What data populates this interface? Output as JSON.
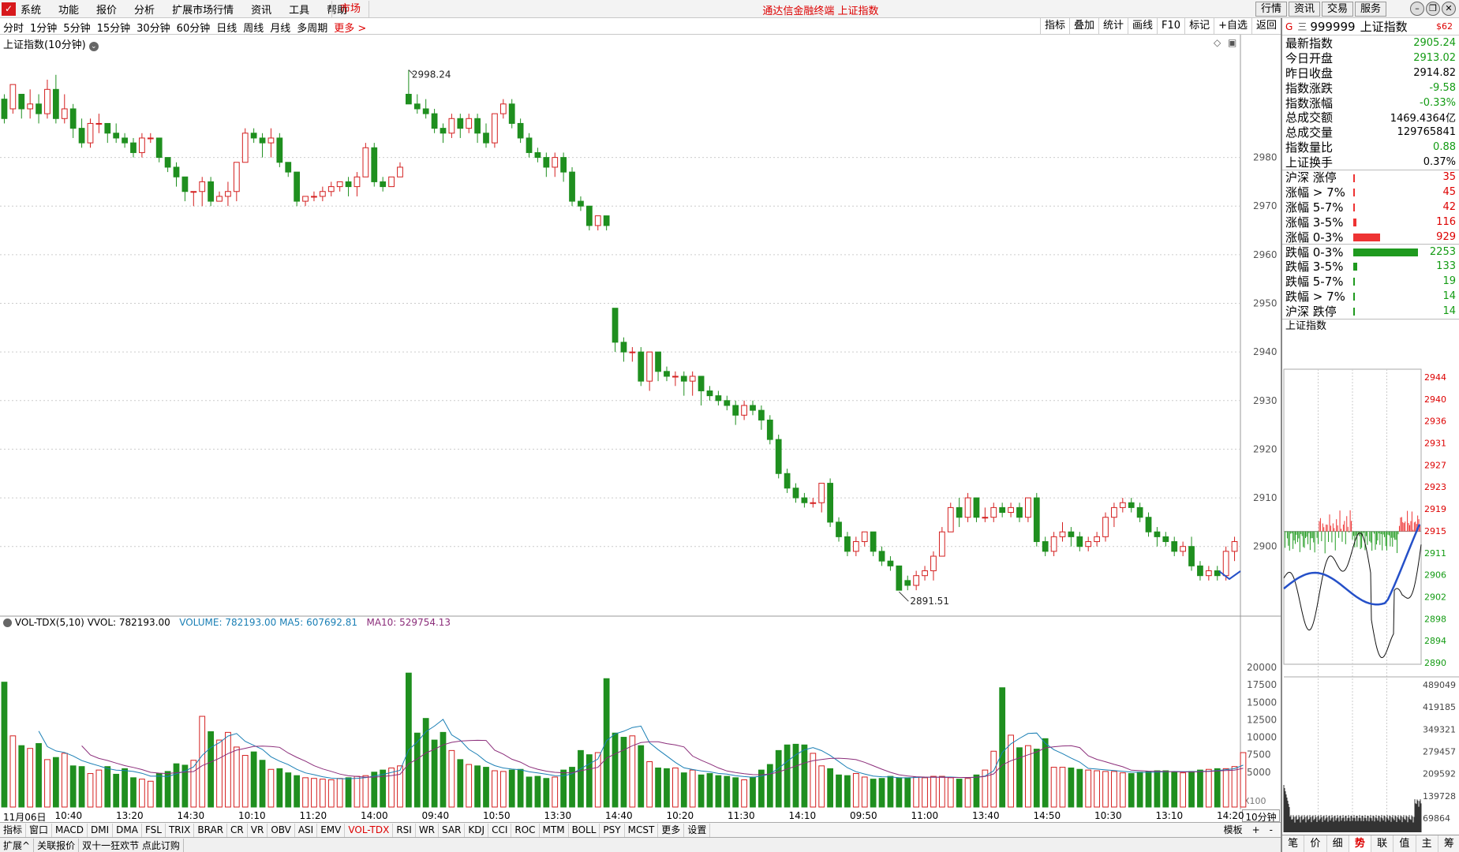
{
  "app": {
    "menu": [
      "系统",
      "功能",
      "报价",
      "分析",
      "扩展市场行情",
      "资讯",
      "工具",
      "帮助"
    ],
    "market_tab": "市场",
    "title": "通达信金融终端  上证指数",
    "right_buttons": [
      "行情",
      "资讯",
      "交易",
      "服务"
    ],
    "window_controls": [
      "minimize-icon",
      "restore-icon",
      "close-icon"
    ]
  },
  "toolbar": {
    "periods": [
      "分时",
      "1分钟",
      "5分钟",
      "15分钟",
      "30分钟",
      "60分钟",
      "日线",
      "周线",
      "月线",
      "多周期"
    ],
    "more": "更多 >",
    "tools": [
      "指标",
      "叠加",
      "统计",
      "画线",
      "F10",
      "标记",
      "+自选",
      "返回"
    ]
  },
  "main_chart": {
    "label": "上证指数(10分钟)",
    "price_axis": [
      "2980",
      "2970",
      "2960",
      "2950",
      "2940",
      "2930",
      "2920",
      "2910",
      "2900"
    ],
    "high_label": "2998.24",
    "low_label": "2891.51",
    "up_color": "#d42020",
    "down_color": "#1f8f1f"
  },
  "chart_data": {
    "type": "candlestick",
    "title": "上证指数(10分钟)",
    "ylim": [
      2886,
      3002
    ],
    "candles": [
      [
        2992,
        2993,
        2988,
        2987
      ],
      [
        2990,
        2995,
        2995,
        2989
      ],
      [
        2993,
        2993,
        2990,
        2988
      ],
      [
        2990,
        2994,
        2991,
        2988
      ],
      [
        2991,
        2993,
        2989,
        2987
      ],
      [
        2989,
        2996,
        2994,
        2988
      ],
      [
        2994,
        2997,
        2988,
        2987
      ],
      [
        2988,
        2993,
        2990,
        2987
      ],
      [
        2990,
        2991,
        2986,
        2984
      ],
      [
        2986,
        2988,
        2983,
        2982
      ],
      [
        2983,
        2988,
        2987,
        2982
      ],
      [
        2987,
        2989,
        2987,
        2985
      ],
      [
        2987,
        2987,
        2985,
        2983
      ],
      [
        2985,
        2987,
        2984,
        2983
      ],
      [
        2984,
        2985,
        2983,
        2982
      ],
      [
        2983,
        2984,
        2981,
        2980
      ],
      [
        2981,
        2985,
        2984,
        2980
      ],
      [
        2984,
        2985,
        2984,
        2983
      ],
      [
        2984,
        2984,
        2980,
        2979
      ],
      [
        2980,
        2980,
        2978,
        2977
      ],
      [
        2978,
        2979,
        2976,
        2974
      ],
      [
        2976,
        2976,
        2973,
        2971
      ],
      [
        2973,
        2973,
        2973,
        2970
      ],
      [
        2973,
        2976,
        2975,
        2970
      ],
      [
        2975,
        2976,
        2971,
        2970
      ],
      [
        2971,
        2973,
        2972,
        2971
      ],
      [
        2972,
        2975,
        2973,
        2970
      ],
      [
        2973,
        2979,
        2979,
        2971
      ],
      [
        2979,
        2986,
        2985,
        2979
      ],
      [
        2985,
        2986,
        2984,
        2983
      ],
      [
        2984,
        2985,
        2983,
        2980
      ],
      [
        2983,
        2986,
        2984,
        2980
      ],
      [
        2984,
        2985,
        2979,
        2978
      ],
      [
        2979,
        2979,
        2977,
        2976
      ],
      [
        2977,
        2977,
        2971,
        2970
      ],
      [
        2971,
        2972,
        2972,
        2970
      ],
      [
        2972,
        2973,
        2972,
        2971
      ],
      [
        2972,
        2974,
        2973,
        2971
      ],
      [
        2973,
        2975,
        2974,
        2972
      ],
      [
        2974,
        2975,
        2975,
        2973
      ],
      [
        2975,
        2976,
        2974,
        2972
      ],
      [
        2974,
        2977,
        2976,
        2972
      ],
      [
        2976,
        2983,
        2982,
        2976
      ],
      [
        2982,
        2983,
        2975,
        2974
      ],
      [
        2975,
        2976,
        2974,
        2973
      ],
      [
        2974,
        2976,
        2976,
        2974
      ],
      [
        2976,
        2979,
        2978,
        2976
      ],
      [
        2993,
        2998,
        2991,
        2991
      ],
      [
        2991,
        2993,
        2990,
        2989
      ],
      [
        2990,
        2992,
        2989,
        2988
      ],
      [
        2989,
        2990,
        2986,
        2985
      ],
      [
        2986,
        2987,
        2985,
        2983
      ],
      [
        2985,
        2989,
        2988,
        2984
      ],
      [
        2988,
        2989,
        2986,
        2984
      ],
      [
        2986,
        2989,
        2988,
        2985
      ],
      [
        2988,
        2989,
        2985,
        2983
      ],
      [
        2985,
        2987,
        2983,
        2982
      ],
      [
        2983,
        2989,
        2989,
        2982
      ],
      [
        2989,
        2992,
        2991,
        2988
      ],
      [
        2991,
        2992,
        2987,
        2986
      ],
      [
        2987,
        2988,
        2984,
        2983
      ],
      [
        2984,
        2985,
        2981,
        2980
      ],
      [
        2981,
        2982,
        2980,
        2979
      ],
      [
        2980,
        2981,
        2978,
        2976
      ],
      [
        2978,
        2981,
        2980,
        2976
      ],
      [
        2980,
        2981,
        2977,
        2975
      ],
      [
        2977,
        2978,
        2971,
        2970
      ],
      [
        2971,
        2972,
        2970,
        2969
      ],
      [
        2970,
        2970,
        2966,
        2965
      ],
      [
        2966,
        2968,
        2968,
        2965
      ],
      [
        2968,
        2968,
        2966,
        2965
      ],
      [
        2949,
        2949,
        2942,
        2940
      ],
      [
        2942,
        2943,
        2940,
        2938
      ],
      [
        2940,
        2941,
        2940,
        2938
      ],
      [
        2940,
        2941,
        2934,
        2933
      ],
      [
        2934,
        2940,
        2940,
        2932
      ],
      [
        2940,
        2940,
        2936,
        2934
      ],
      [
        2936,
        2937,
        2935,
        2934
      ],
      [
        2935,
        2936,
        2935,
        2933
      ],
      [
        2935,
        2936,
        2934,
        2931
      ],
      [
        2934,
        2936,
        2935,
        2931
      ],
      [
        2935,
        2935,
        2932,
        2929
      ],
      [
        2932,
        2933,
        2931,
        2930
      ],
      [
        2931,
        2932,
        2930,
        2929
      ],
      [
        2930,
        2931,
        2929,
        2928
      ],
      [
        2929,
        2930,
        2927,
        2925
      ],
      [
        2927,
        2930,
        2929,
        2926
      ],
      [
        2929,
        2930,
        2928,
        2927
      ],
      [
        2928,
        2929,
        2926,
        2924
      ],
      [
        2926,
        2927,
        2922,
        2921
      ],
      [
        2922,
        2923,
        2915,
        2914
      ],
      [
        2915,
        2916,
        2912,
        2911
      ],
      [
        2912,
        2913,
        2910,
        2909
      ],
      [
        2910,
        2911,
        2909,
        2908
      ],
      [
        2909,
        2910,
        2909,
        2908
      ],
      [
        2909,
        2913,
        2913,
        2907
      ],
      [
        2913,
        2914,
        2905,
        2904
      ],
      [
        2905,
        2906,
        2902,
        2901
      ],
      [
        2902,
        2903,
        2899,
        2898
      ],
      [
        2899,
        2902,
        2901,
        2898
      ],
      [
        2901,
        2903,
        2903,
        2900
      ],
      [
        2903,
        2903,
        2899,
        2898
      ],
      [
        2899,
        2900,
        2897,
        2896
      ],
      [
        2897,
        2898,
        2896,
        2895
      ],
      [
        2896,
        2896,
        2891,
        2891
      ],
      [
        2893,
        2894,
        2892,
        2891
      ],
      [
        2892,
        2895,
        2894,
        2891
      ],
      [
        2894,
        2896,
        2895,
        2893
      ],
      [
        2895,
        2899,
        2898,
        2893
      ],
      [
        2898,
        2904,
        2903,
        2898
      ],
      [
        2903,
        2909,
        2908,
        2903
      ],
      [
        2908,
        2910,
        2906,
        2904
      ],
      [
        2906,
        2911,
        2910,
        2905
      ],
      [
        2910,
        2910,
        2906,
        2905
      ],
      [
        2906,
        2908,
        2906,
        2905
      ],
      [
        2906,
        2909,
        2908,
        2905
      ],
      [
        2908,
        2909,
        2907,
        2906
      ],
      [
        2907,
        2909,
        2908,
        2906
      ],
      [
        2908,
        2909,
        2906,
        2905
      ],
      [
        2906,
        2910,
        2910,
        2905
      ],
      [
        2910,
        2911,
        2901,
        2900
      ],
      [
        2901,
        2902,
        2899,
        2898
      ],
      [
        2899,
        2903,
        2902,
        2898
      ],
      [
        2902,
        2905,
        2903,
        2901
      ],
      [
        2903,
        2904,
        2902,
        2900
      ],
      [
        2902,
        2903,
        2900,
        2899
      ],
      [
        2900,
        2902,
        2901,
        2899
      ],
      [
        2901,
        2903,
        2902,
        2900
      ],
      [
        2902,
        2907,
        2906,
        2901
      ],
      [
        2906,
        2909,
        2908,
        2904
      ],
      [
        2908,
        2910,
        2909,
        2907
      ],
      [
        2909,
        2910,
        2908,
        2907
      ],
      [
        2908,
        2909,
        2906,
        2905
      ],
      [
        2906,
        2907,
        2903,
        2902
      ],
      [
        2903,
        2904,
        2902,
        2900
      ],
      [
        2902,
        2903,
        2901,
        2900
      ],
      [
        2901,
        2902,
        2899,
        2898
      ],
      [
        2899,
        2901,
        2900,
        2898
      ],
      [
        2900,
        2902,
        2896,
        2895
      ],
      [
        2896,
        2897,
        2894,
        2893
      ],
      [
        2894,
        2896,
        2895,
        2893
      ],
      [
        2895,
        2896,
        2894,
        2893
      ],
      [
        2894,
        2900,
        2899,
        2893
      ],
      [
        2899,
        2902,
        2901,
        2897
      ]
    ]
  },
  "volume": {
    "header": [
      "VOL-TDX(5,10)",
      "VVOL: 782193.00"
    ],
    "header_series": [
      "VOLUME: 782193.00",
      "MA5: 607692.81",
      "MA10: 529754.13"
    ],
    "axis": [
      "20000",
      "17500",
      "15000",
      "12500",
      "10000",
      "7500",
      "5000"
    ],
    "unit": "X100",
    "values": [
      17900,
      10200,
      8800,
      8400,
      9100,
      6800,
      7100,
      7700,
      5900,
      5800,
      4800,
      5300,
      5800,
      4700,
      5500,
      4200,
      4000,
      3700,
      4800,
      5100,
      6200,
      6000,
      6700,
      13000,
      10800,
      9600,
      10700,
      8600,
      7400,
      7900,
      6700,
      5400,
      5500,
      4900,
      4500,
      4200,
      4100,
      4000,
      3900,
      4100,
      4200,
      4400,
      4500,
      5000,
      5300,
      5600,
      5900,
      19200,
      10600,
      12700,
      9600,
      10700,
      8100,
      6800,
      6100,
      5900,
      5700,
      5200,
      5100,
      5300,
      5400,
      4300,
      4400,
      4100,
      4300,
      5300,
      5700,
      8100,
      7500,
      7800,
      18400,
      10600,
      10000,
      10200,
      8800,
      6500,
      5600,
      5500,
      5600,
      4900,
      5300,
      4600,
      4800,
      4500,
      4400,
      4200,
      3900,
      4300,
      5300,
      6100,
      8100,
      8900,
      9000,
      8900,
      7700,
      5900,
      5500,
      4600,
      4500,
      4800,
      4300,
      4000,
      4100,
      4400,
      4200,
      4200,
      4300,
      4200,
      4400,
      4400,
      4200,
      4000,
      4100,
      4600,
      5300,
      8000,
      17100,
      10300,
      8500,
      8800,
      8300,
      9800,
      5700,
      5700,
      5600,
      5400,
      5300,
      5200,
      5100,
      5100,
      4900,
      4800,
      5000,
      5100,
      5200,
      5200,
      5000,
      4900,
      5100,
      5300,
      5400,
      5500,
      5500,
      5800,
      7800
    ]
  },
  "x_axis": {
    "labels": [
      "11月06日",
      "10:40",
      "13:20",
      "14:30",
      "10:10",
      "11:20",
      "14:00",
      "09:40",
      "10:50",
      "13:30",
      "14:40",
      "10:20",
      "11:30",
      "14:10",
      "09:50",
      "11:00",
      "13:40",
      "14:50",
      "10:30",
      "13:10",
      "14:20"
    ],
    "period": "10分钟"
  },
  "indicator_tabs": [
    "指标",
    "窗口",
    "MACD",
    "DMI",
    "DMA",
    "FSL",
    "TRIX",
    "BRAR",
    "CR",
    "VR",
    "OBV",
    "ASI",
    "EMV",
    "VOL-TDX",
    "RSI",
    "WR",
    "SAR",
    "KDJ",
    "CCI",
    "ROC",
    "MTM",
    "BOLL",
    "PSY",
    "MCST",
    "更多",
    "设置"
  ],
  "indicator_active": "VOL-TDX",
  "indicator_right": [
    "模板",
    "+",
    "-"
  ],
  "status": [
    "扩展^",
    "关联报价",
    "双十一狂欢节 点此订购"
  ],
  "quote": {
    "code": "999999",
    "name": "上证指数",
    "g": "G",
    "e": "三",
    "count": "$62",
    "rows": [
      {
        "label": "最新指数",
        "value": "2905.24",
        "color": "green"
      },
      {
        "label": "今日开盘",
        "value": "2913.02",
        "color": "green"
      },
      {
        "label": "昨日收盘",
        "value": "2914.82",
        "color": "black"
      },
      {
        "label": "指数涨跌",
        "value": "-9.58",
        "color": "green"
      },
      {
        "label": "指数涨幅",
        "value": "-0.33%",
        "color": "green"
      },
      {
        "label": "总成交额",
        "value": "1469.4364亿",
        "color": "black"
      },
      {
        "label": "总成交量",
        "value": "129765841",
        "color": "black"
      },
      {
        "label": "指数量比",
        "value": "0.88",
        "color": "green"
      },
      {
        "label": "上证换手",
        "value": "0.37%",
        "color": "black"
      }
    ],
    "breadth_up": [
      {
        "label": "沪深 涨停",
        "value": "35",
        "share": 0.015
      },
      {
        "label": "涨幅 > 7%",
        "value": "45",
        "share": 0.02
      },
      {
        "label": "涨幅 5-7%",
        "value": "42",
        "share": 0.018
      },
      {
        "label": "涨幅 3-5%",
        "value": "116",
        "share": 0.05
      },
      {
        "label": "涨幅 0-3%",
        "value": "929",
        "share": 0.41
      }
    ],
    "breadth_down": [
      {
        "label": "跌幅 0-3%",
        "value": "2253",
        "share": 1.0
      },
      {
        "label": "跌幅 3-5%",
        "value": "133",
        "share": 0.059
      },
      {
        "label": "跌幅 5-7%",
        "value": "19",
        "share": 0.01
      },
      {
        "label": "跌幅 > 7%",
        "value": "14",
        "share": 0.01
      },
      {
        "label": "沪深 跌停",
        "value": "14",
        "share": 0.01
      }
    ],
    "mini_title": "上证指数",
    "mini_axis": [
      "2944",
      "2940",
      "2936",
      "2931",
      "2927",
      "2923",
      "2919",
      "2915",
      "2911",
      "2906",
      "2902",
      "2898",
      "2894",
      "2890"
    ],
    "mini_vol_axis": [
      "489049",
      "419185",
      "349321",
      "279457",
      "209592",
      "139728",
      "69864"
    ],
    "bottom_tabs": [
      "笔",
      "价",
      "细",
      "势",
      "联",
      "值",
      "主",
      "筹"
    ],
    "bottom_active": "势"
  }
}
